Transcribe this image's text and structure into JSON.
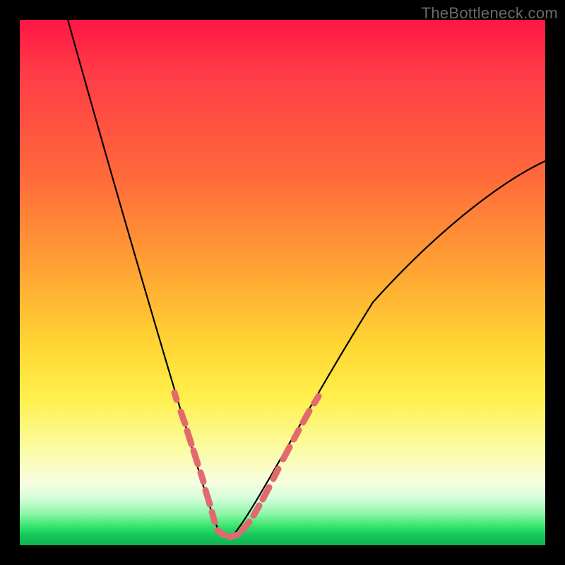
{
  "watermark_text": "TheBottleneck.com",
  "chart_data": {
    "type": "line",
    "title": "",
    "xlabel": "",
    "ylabel": "",
    "xlim": [
      0,
      100
    ],
    "ylim": [
      0,
      100
    ],
    "grid": false,
    "annotations": [
      {
        "text": "TheBottleneck.com",
        "position": "top-right"
      }
    ],
    "background_gradient": {
      "direction": "top-to-bottom",
      "stops": [
        {
          "pos": 0.0,
          "color": "#ff1744"
        },
        {
          "pos": 0.3,
          "color": "#ff6a3a"
        },
        {
          "pos": 0.62,
          "color": "#ffd633"
        },
        {
          "pos": 0.82,
          "color": "#fbfca6"
        },
        {
          "pos": 0.94,
          "color": "#8ff7a8"
        },
        {
          "pos": 1.0,
          "color": "#10b352"
        }
      ]
    },
    "series": [
      {
        "name": "curve",
        "color": "#000000",
        "segments": [
          {
            "side": "left",
            "x": [
              9,
              12,
              15,
              18,
              21,
              24,
              27,
              30,
              32,
              34,
              35.5,
              37
            ],
            "y": [
              100,
              84,
              70,
              57,
              45,
              34,
              24.5,
              16,
              10.5,
              6,
              3,
              1.5
            ]
          },
          {
            "side": "right",
            "x": [
              42,
              44,
              47,
              51,
              56,
              62,
              69,
              77,
              86,
              94,
              100
            ],
            "y": [
              1.5,
              3,
              7,
              13,
              21,
              30,
              39,
              47,
              55,
              60,
              64
            ]
          }
        ]
      },
      {
        "name": "dash-markers",
        "color": "#e96a6f",
        "description": "short thick pink dashes overlaid on lower portion of both arms of the V-curve",
        "left_arm_y_range": [
          5,
          29
        ],
        "right_arm_y_range": [
          5,
          29
        ],
        "dash_width": 9,
        "dash_thickness": 9
      }
    ],
    "floor_marker": {
      "color": "#e96a6f",
      "x_range": [
        35,
        43
      ],
      "y": 1.5,
      "dash_count": 3
    }
  }
}
